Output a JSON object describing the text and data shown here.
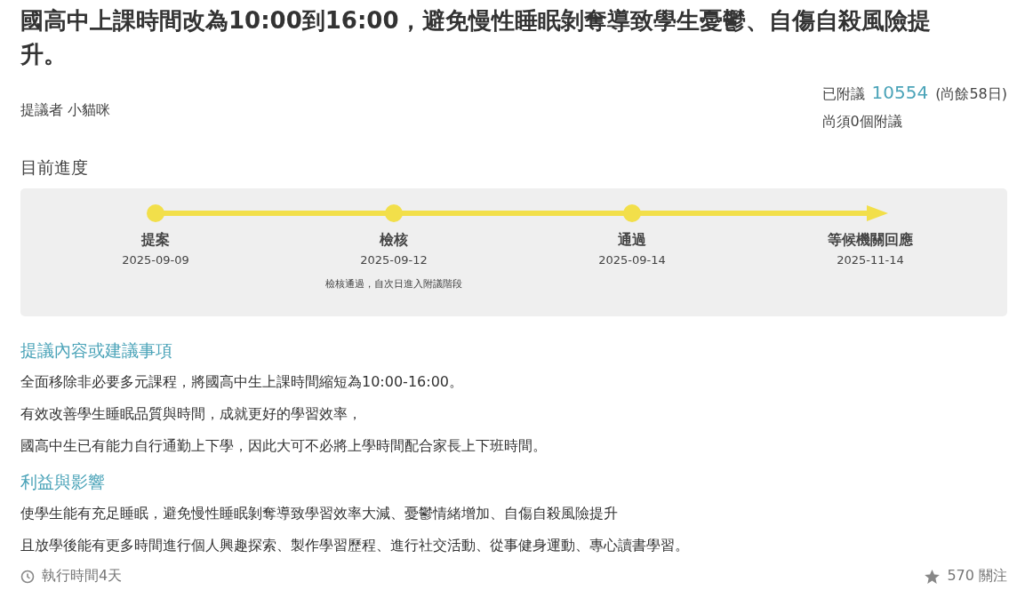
{
  "title": "國高中上課時間改為10:00到16:00，避免慢性睡眠剝奪導致學生憂鬱、自傷自殺風險提升。",
  "proposer": {
    "label": "提議者",
    "name": "小貓咪"
  },
  "endorse": {
    "label": "已附議",
    "count": "10554",
    "remaining": "(尚餘58日)",
    "needed": "尚須0個附議"
  },
  "progress": {
    "heading": "目前進度",
    "steps": [
      {
        "label": "提案",
        "date": "2025-09-09"
      },
      {
        "label": "檢核",
        "date": "2025-09-12",
        "note": "檢核通過，自次日進入附議階段"
      },
      {
        "label": "通過",
        "date": "2025-09-14"
      },
      {
        "label": "等候機關回應",
        "date": "2025-11-14"
      }
    ]
  },
  "sections": [
    {
      "heading": "提議內容或建議事項",
      "lines": [
        "全面移除非必要多元課程，將國高中生上課時間縮短為10:00-16:00。",
        "有效改善學生睡眠品質與時間，成就更好的學習效率，",
        "國高中生已有能力自行通勤上下學，因此大可不必將上學時間配合家長上下班時間。"
      ]
    },
    {
      "heading": "利益與影響",
      "lines": [
        "使學生能有充足睡眠，避免慢性睡眠剝奪導致學習效率大減、憂鬱情緒增加、自傷自殺風險提升",
        "且放學後能有更多時間進行個人興趣探索、製作學習歷程、進行社交活動、從事健身運動、專心讀書學習。"
      ]
    }
  ],
  "footer": {
    "duration": "執行時間4天",
    "follows": "570 關注"
  }
}
